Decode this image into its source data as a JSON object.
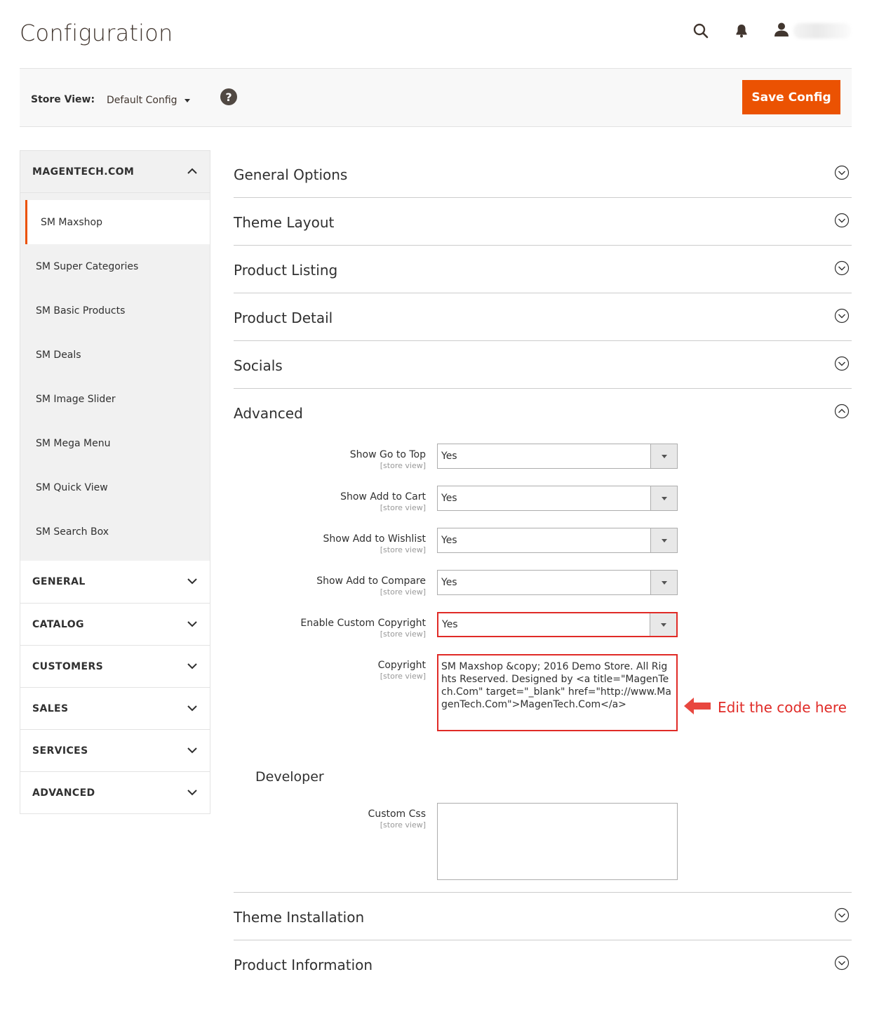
{
  "page": {
    "title": "Configuration"
  },
  "header": {
    "user_name": "admin"
  },
  "toolbar": {
    "store_view_label": "Store View:",
    "store_view_value": "Default Config",
    "help": "?",
    "save_label": "Save Config"
  },
  "sidebar": {
    "group_title": "MAGENTECH.COM",
    "items": [
      {
        "label": "SM Maxshop"
      },
      {
        "label": "SM Super Categories"
      },
      {
        "label": "SM Basic Products"
      },
      {
        "label": "SM Deals"
      },
      {
        "label": "SM Image Slider"
      },
      {
        "label": "SM Mega Menu"
      },
      {
        "label": "SM Quick View"
      },
      {
        "label": "SM Search Box"
      }
    ],
    "sections": [
      {
        "label": "GENERAL"
      },
      {
        "label": "CATALOG"
      },
      {
        "label": "CUSTOMERS"
      },
      {
        "label": "SALES"
      },
      {
        "label": "SERVICES"
      },
      {
        "label": "ADVANCED"
      }
    ]
  },
  "main": {
    "sections_top": [
      {
        "title": "General Options"
      },
      {
        "title": "Theme Layout"
      },
      {
        "title": "Product Listing"
      },
      {
        "title": "Product Detail"
      },
      {
        "title": "Socials"
      }
    ],
    "advanced": {
      "title": "Advanced",
      "fields": [
        {
          "label": "Show Go to Top",
          "scope": "[store view]",
          "value": "Yes"
        },
        {
          "label": "Show Add to Cart",
          "scope": "[store view]",
          "value": "Yes"
        },
        {
          "label": "Show Add to Wishlist",
          "scope": "[store view]",
          "value": "Yes"
        },
        {
          "label": "Show Add to Compare",
          "scope": "[store view]",
          "value": "Yes"
        },
        {
          "label": "Enable Custom Copyright",
          "scope": "[store view]",
          "value": "Yes"
        }
      ],
      "copyright": {
        "label": "Copyright",
        "scope": "[store view]",
        "value": "SM Maxshop &copy; 2016 Demo Store. All Rights Reserved. Designed by <a title=\"MagenTech.Com\" target=\"_blank\" href=\"http://www.MagenTech.Com\">MagenTech.Com</a>"
      },
      "annotation": "Edit the code here",
      "developer": {
        "title": "Developer",
        "custom_css": {
          "label": "Custom Css",
          "scope": "[store view]",
          "value": ""
        }
      }
    },
    "sections_bottom": [
      {
        "title": "Theme Installation"
      },
      {
        "title": "Product Information"
      }
    ]
  },
  "colors": {
    "accent": "#eb5202",
    "highlight": "#e02b27"
  }
}
